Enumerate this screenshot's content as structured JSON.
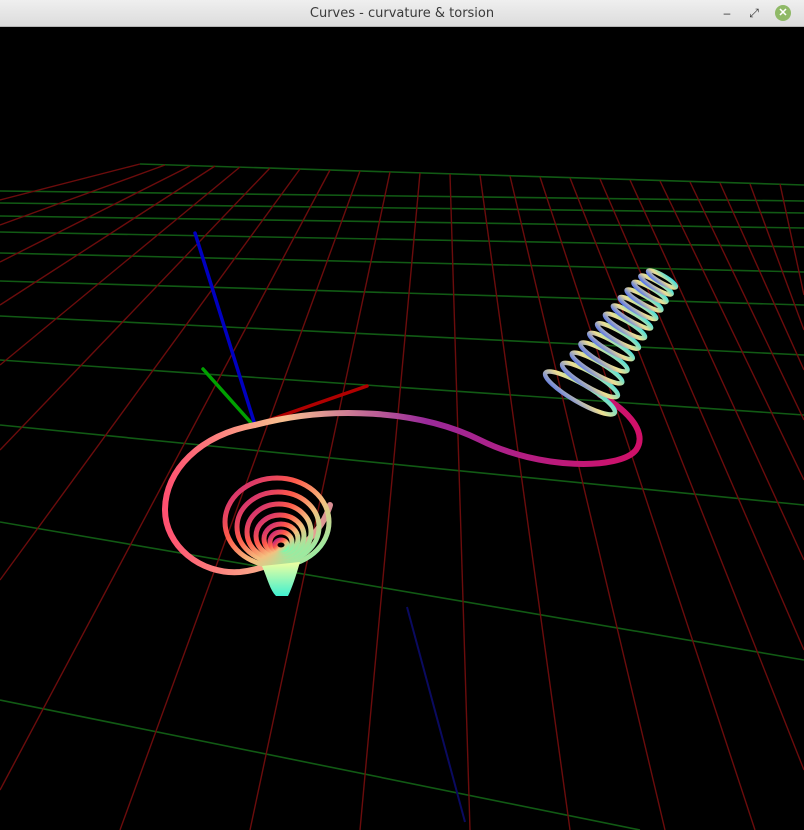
{
  "window": {
    "title": "Curves - curvature & torsion",
    "controls": {
      "minimize": "–",
      "maximize": "⤢",
      "close": "✕"
    }
  },
  "scene": {
    "background": "#000000",
    "grid_colors": {
      "red_lines": "#6a0f0f",
      "green_lines": "#0f5a12"
    },
    "axes_colors": {
      "x": "#c00000",
      "y": "#00a000",
      "z": "#0000c8"
    },
    "curve_gradient": [
      "#ff4f6e",
      "#f8b07a",
      "#a0ff9a",
      "#5fffe0",
      "#8a1aa0",
      "#c01070"
    ]
  }
}
